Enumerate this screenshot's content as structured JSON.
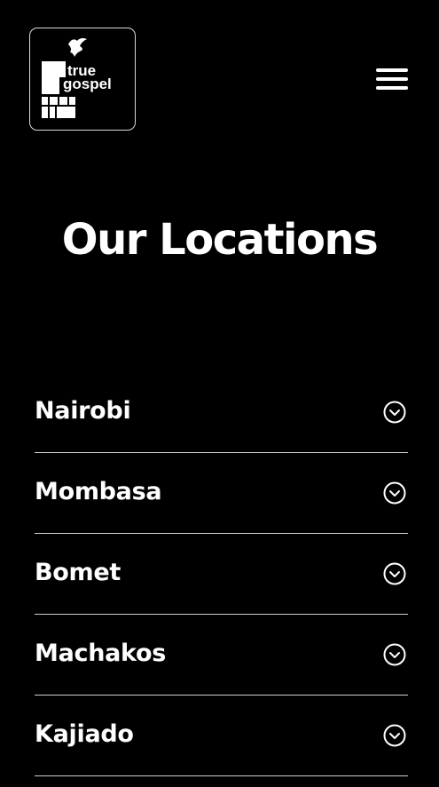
{
  "header": {
    "logo_text_line1": "true",
    "logo_text_line2": "gospel",
    "logo_icon": "dove-icon",
    "menu_icon": "hamburger-menu-icon"
  },
  "main": {
    "title": "Our Locations"
  },
  "locations": [
    {
      "label": "Nairobi",
      "icon": "chevron-down-circle-icon"
    },
    {
      "label": "Mombasa",
      "icon": "chevron-down-circle-icon"
    },
    {
      "label": "Bomet",
      "icon": "chevron-down-circle-icon"
    },
    {
      "label": "Machakos",
      "icon": "chevron-down-circle-icon"
    },
    {
      "label": "Kajiado",
      "icon": "chevron-down-circle-icon"
    }
  ],
  "colors": {
    "background": "#000000",
    "text": "#ffffff",
    "divider": "#d0d0d0"
  }
}
